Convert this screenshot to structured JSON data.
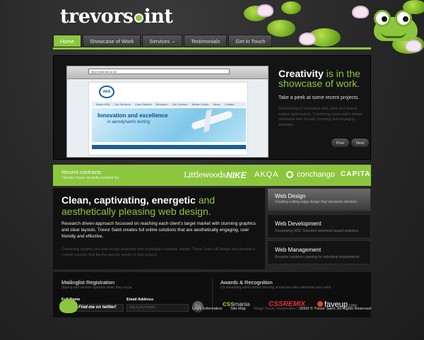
{
  "brand": {
    "logo_pre": "trevors",
    "logo_post": "int"
  },
  "nav": [
    {
      "label": "Home",
      "active": true
    },
    {
      "label": "Showcase of Work",
      "active": false
    },
    {
      "label": "Services",
      "active": false
    },
    {
      "label": "Testimonials",
      "active": false
    },
    {
      "label": "Get in Touch",
      "active": false
    }
  ],
  "showcase": {
    "url": "http://www.ara.ac.uk",
    "site_logo": "ARA",
    "site_menu": [
      "About ARA",
      "Our Services",
      "Case Studies",
      "Research",
      "Our Careers",
      "Media Centre",
      "News",
      "Contact"
    ],
    "hero_title": "Innovation and excellence",
    "hero_sub": "in aerodynamic testing",
    "headline_bold": "Creativity",
    "headline_rest": " is in the showcase of work.",
    "lead": "Take a peek at some recent projects.",
    "desc": "Specialising in innovative web, print and search engine optimisation. Combining impeccable design standards with visually stunning and engaging websites.",
    "prev": "Prev",
    "next": "Next"
  },
  "contracts": {
    "title": "Recent contracts",
    "subtitle": "Clients I have recently worked for",
    "clients": [
      "Littlewoods",
      "NIKE",
      "AKQA",
      "conchango",
      "CAPITA"
    ]
  },
  "intro": {
    "headline_bold": "Clean, captivating, energetic",
    "headline_rest": " and aesthetically pleasing web design.",
    "p1": "Research driven-approach focussed on reaching each client's target market with stunning graphics and clear layouts. Trevor Saint creates full online solutions that are aesthetically engaging, user friendly and effective.",
    "p2": "Combining graphic and web design expertise with invaluable customer insight, Trevor Saint will design and develop a custom solution that fits the specific needs of your project."
  },
  "services": [
    {
      "title": "Web Design",
      "desc": "Creating cutting-edge design that demands attention."
    },
    {
      "title": "Web Development",
      "desc": "Developing W3C Standard optimised based websites."
    },
    {
      "title": "Web Management",
      "desc": "Bespoke solutions catering for individual requirements."
    }
  ],
  "mailing": {
    "title": "Mailinglist Registration",
    "subtitle": "Signup and receive updates when they occur.",
    "name_label": "Full Name",
    "name_placeholder": "Input your name...",
    "email_label": "Email Address",
    "email_placeholder": "Input your email...",
    "go": "Go"
  },
  "awards": {
    "title": "Awards & Recognition",
    "subtitle": "It's rewarding when award winning showcase sites advertise your work.",
    "a1_pre": "css",
    "a1_post": "mania",
    "a2": "CSSREMIX",
    "a3": "faveup",
    "a3_suffix": ".com"
  },
  "footer": {
    "twitter": "Find me on twitter!",
    "legal": "Legal Information",
    "sitemap": "Site Map",
    "address": "Kings Court, Harpenden UK",
    "copyright": "2009 © Trevor Saint. All Rights Reserved"
  },
  "colors": {
    "accent": "#8cc63f",
    "background": "#2a2a2a",
    "panel": "#111111"
  }
}
